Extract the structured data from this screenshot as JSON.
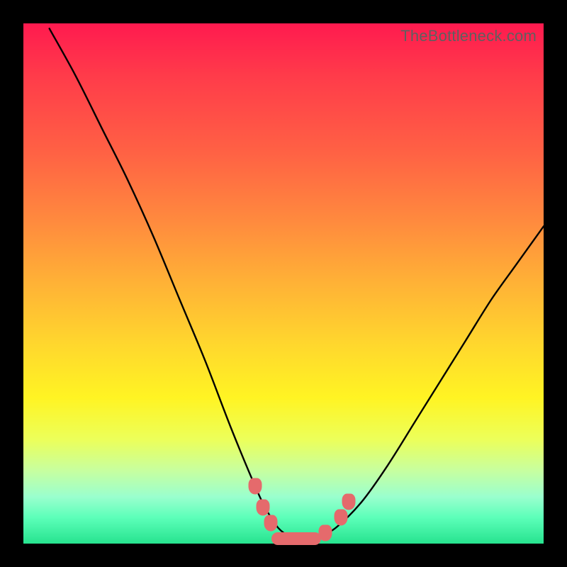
{
  "attribution": "TheBottleneck.com",
  "colors": {
    "frame": "#000000",
    "marker": "#e56a6c",
    "curve": "#000000"
  },
  "chart_data": {
    "type": "line",
    "title": "",
    "xlabel": "",
    "ylabel": "",
    "xlim": [
      0,
      100
    ],
    "ylim": [
      0,
      100
    ],
    "grid": false,
    "series": [
      {
        "name": "bottleneck-curve",
        "x": [
          5,
          10,
          15,
          20,
          25,
          30,
          35,
          40,
          45,
          47,
          49,
          51,
          53,
          55,
          57,
          60,
          65,
          70,
          75,
          80,
          85,
          90,
          95,
          100
        ],
        "y": [
          99,
          90,
          80,
          70,
          59,
          47,
          35,
          22,
          10,
          6,
          3,
          1.5,
          1,
          1,
          1.5,
          3,
          8,
          15,
          23,
          31,
          39,
          47,
          54,
          61
        ]
      }
    ],
    "markers": [
      {
        "x": 44.5,
        "y": 11
      },
      {
        "x": 46.0,
        "y": 7
      },
      {
        "x": 47.5,
        "y": 4
      },
      {
        "x": 52.5,
        "y": 1,
        "wide": true
      },
      {
        "x": 58.0,
        "y": 2
      },
      {
        "x": 61.0,
        "y": 5
      },
      {
        "x": 62.5,
        "y": 8
      }
    ]
  }
}
